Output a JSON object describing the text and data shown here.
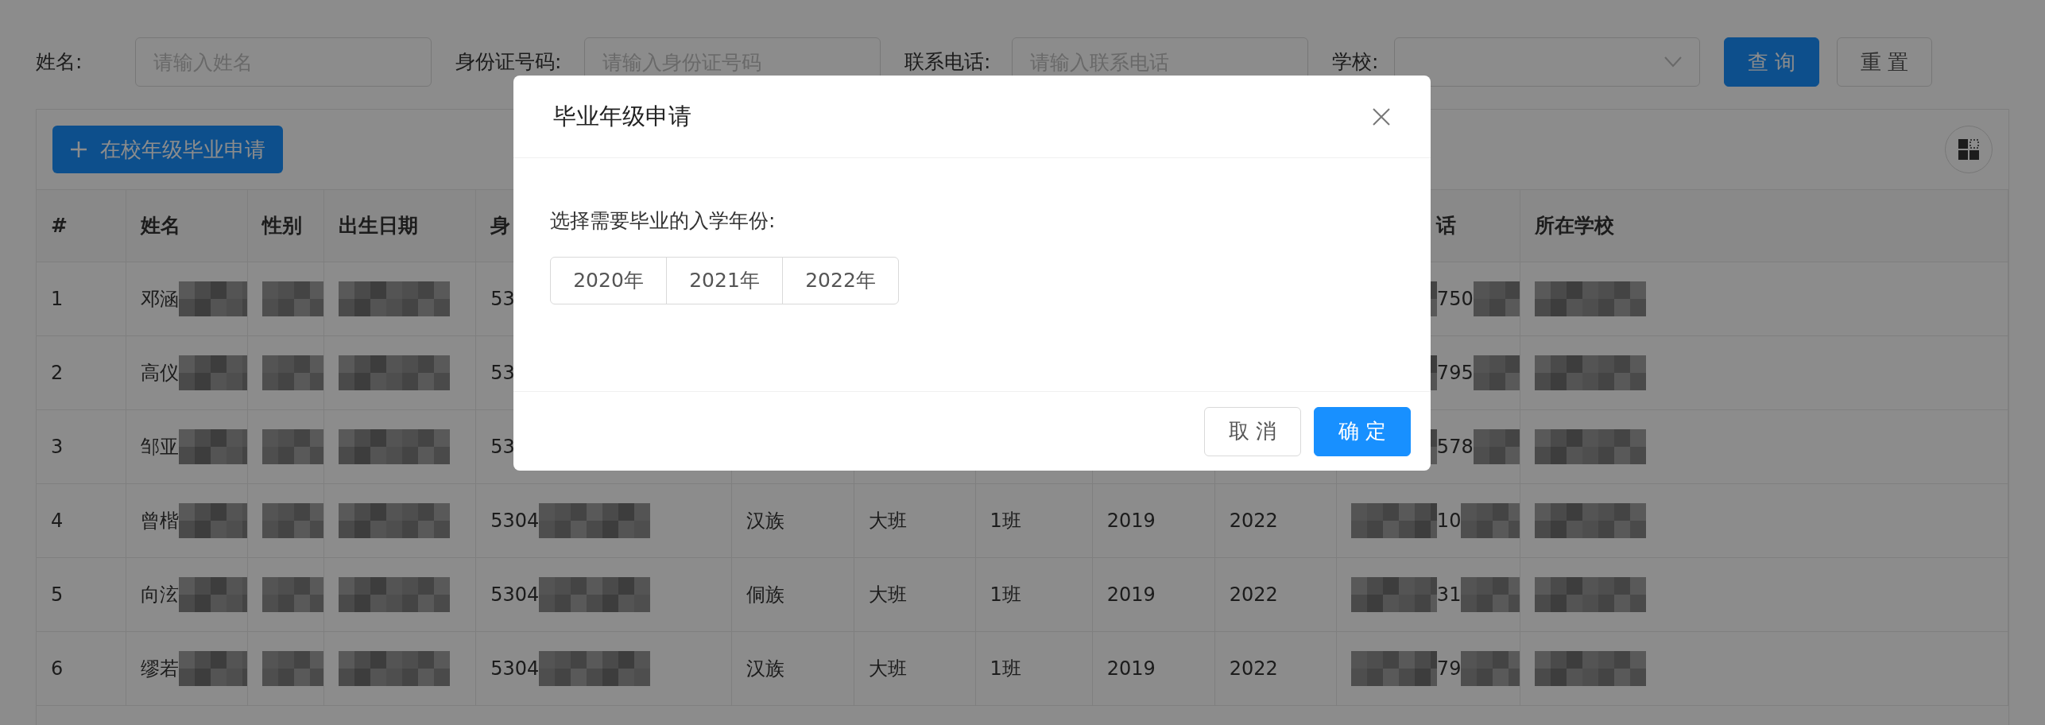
{
  "query_form": {
    "fields": [
      {
        "kind": "input",
        "label": "姓名:",
        "placeholder": "请输入姓名"
      },
      {
        "kind": "input",
        "label": "身份证号码:",
        "placeholder": "请输入身份证号码"
      },
      {
        "kind": "input",
        "label": "联系电话:",
        "placeholder": "请输入联系电话"
      },
      {
        "kind": "select",
        "label": "学校:"
      }
    ],
    "buttons": [
      {
        "label": "查 询",
        "kind": "primary"
      },
      {
        "label": "重 置",
        "kind": "default"
      }
    ]
  },
  "toolbar": {
    "add_button": "在校年级毕业申请"
  },
  "table": {
    "columns": [
      "#",
      "姓名",
      "性别",
      "出生日期",
      "身",
      null,
      null,
      null,
      null,
      null,
      "话",
      "所在学校"
    ],
    "rows": [
      {
        "cells": [
          {
            "text": "1"
          },
          {
            "text": "邓涵",
            "redacted": true
          },
          {
            "redacted": true
          },
          {
            "redacted": true
          },
          {
            "text": "53"
          },
          null,
          null,
          null,
          null,
          null,
          {
            "text": "750",
            "redacted": true
          },
          {
            "redacted": true
          }
        ]
      },
      {
        "cells": [
          {
            "text": "2"
          },
          {
            "text": "高仪",
            "redacted": true
          },
          {
            "redacted": true
          },
          {
            "redacted": true
          },
          {
            "text": "53"
          },
          null,
          null,
          null,
          null,
          null,
          {
            "text": "795",
            "redacted": true
          },
          {
            "redacted": true
          }
        ]
      },
      {
        "cells": [
          {
            "text": "3"
          },
          {
            "text": "邹亚",
            "redacted": true
          },
          {
            "redacted": true
          },
          {
            "redacted": true
          },
          {
            "text": "53"
          },
          null,
          null,
          null,
          null,
          null,
          {
            "text": "578",
            "redacted": true
          },
          {
            "redacted": true
          }
        ]
      },
      {
        "cells": [
          {
            "text": "4"
          },
          {
            "text": "曾楷",
            "redacted": true
          },
          {
            "redacted": true
          },
          {
            "redacted": true
          },
          {
            "text": "5304",
            "redacted": true
          },
          {
            "text": "汉族"
          },
          {
            "text": "大班"
          },
          {
            "text": "1班"
          },
          {
            "text": "2019"
          },
          {
            "text": "2022"
          },
          {
            "text": "10",
            "redacted": true
          },
          {
            "redacted": true
          }
        ]
      },
      {
        "cells": [
          {
            "text": "5"
          },
          {
            "text": "向泫",
            "redacted": true
          },
          {
            "redacted": true
          },
          {
            "redacted": true
          },
          {
            "text": "5304",
            "redacted": true
          },
          {
            "text": "侗族"
          },
          {
            "text": "大班"
          },
          {
            "text": "1班"
          },
          {
            "text": "2019"
          },
          {
            "text": "2022"
          },
          {
            "text": "31",
            "redacted": true
          },
          {
            "redacted": true
          }
        ]
      },
      {
        "cells": [
          {
            "text": "6"
          },
          {
            "text": "缪若",
            "redacted": true
          },
          {
            "redacted": true
          },
          {
            "redacted": true
          },
          {
            "text": "5304",
            "redacted": true
          },
          {
            "text": "汉族"
          },
          {
            "text": "大班"
          },
          {
            "text": "1班"
          },
          {
            "text": "2019"
          },
          {
            "text": "2022"
          },
          {
            "text": "79",
            "redacted": true
          },
          {
            "redacted": true
          }
        ]
      }
    ]
  },
  "dialog": {
    "title": "毕业年级申请",
    "prompt": "选择需要毕业的入学年份:",
    "years": [
      "2020年",
      "2021年",
      "2022年"
    ],
    "buttons": [
      {
        "label": "取 消",
        "kind": "default"
      },
      {
        "label": "确 定",
        "kind": "primary"
      }
    ]
  }
}
